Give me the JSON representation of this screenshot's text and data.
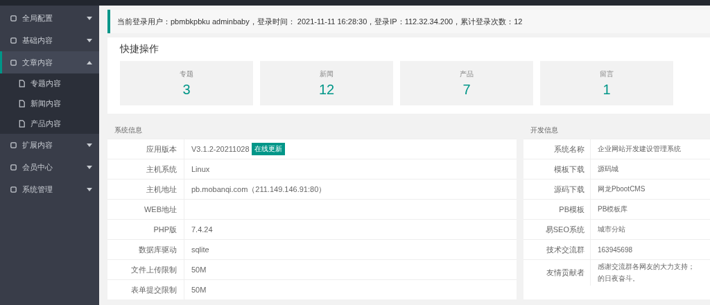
{
  "sidebar": {
    "items": [
      {
        "label": "全局配置",
        "expanded": false,
        "selected": false
      },
      {
        "label": "基础内容",
        "expanded": false,
        "selected": false
      },
      {
        "label": "文章内容",
        "expanded": true,
        "selected": true,
        "children": [
          {
            "label": "专题内容"
          },
          {
            "label": "新闻内容"
          },
          {
            "label": "产品内容"
          }
        ]
      },
      {
        "label": "扩展内容",
        "expanded": false,
        "selected": false
      },
      {
        "label": "会员中心",
        "expanded": false,
        "selected": false
      },
      {
        "label": "系统管理",
        "expanded": false,
        "selected": false
      }
    ]
  },
  "login_notice": "当前登录用户：pbmbkpbku adminbaby，登录时间： 2021-11-11 16:28:30，登录IP：112.32.34.200，累计登录次数：12",
  "quick_actions": {
    "title": "快捷操作",
    "cards": [
      {
        "label": "专题",
        "count": "3"
      },
      {
        "label": "新闻",
        "count": "12"
      },
      {
        "label": "产品",
        "count": "7"
      },
      {
        "label": "留言",
        "count": "1"
      }
    ]
  },
  "system_info": {
    "title": "系统信息",
    "rows": [
      {
        "label": "应用版本",
        "value": "V3.1.2-20211028",
        "badge": "在线更新"
      },
      {
        "label": "主机系统",
        "value": "Linux"
      },
      {
        "label": "主机地址",
        "value": "pb.mobanqi.com（211.149.146.91:80）"
      },
      {
        "label": "WEB地址"
      },
      {
        "label": "PHP版",
        "value": "7.4.24"
      },
      {
        "label": "数据库驱动",
        "value": "sqlite"
      },
      {
        "label": "文件上传限制",
        "value": "50M"
      },
      {
        "label": "表单提交限制",
        "value": "50M"
      }
    ]
  },
  "dev_info": {
    "title": "开发信息",
    "rows": [
      {
        "label": "系统名称",
        "lines": [
          "企业网站开发建设管理系统"
        ]
      },
      {
        "label": "模板下载",
        "lines": [
          "源码城"
        ]
      },
      {
        "label": "源码下载",
        "lines": [
          "网龙PbootCMS"
        ]
      },
      {
        "label": "PB模板",
        "lines": [
          "PB模板库"
        ]
      },
      {
        "label": "易SEO系统",
        "lines": [
          "城市分站"
        ]
      },
      {
        "label": "技术交流群",
        "lines": [
          "163945698"
        ]
      },
      {
        "label": "友情贡献者",
        "lines": [
          "感谢交流群各网友的大力支持；",
          "的日夜奋斗。"
        ]
      }
    ]
  }
}
